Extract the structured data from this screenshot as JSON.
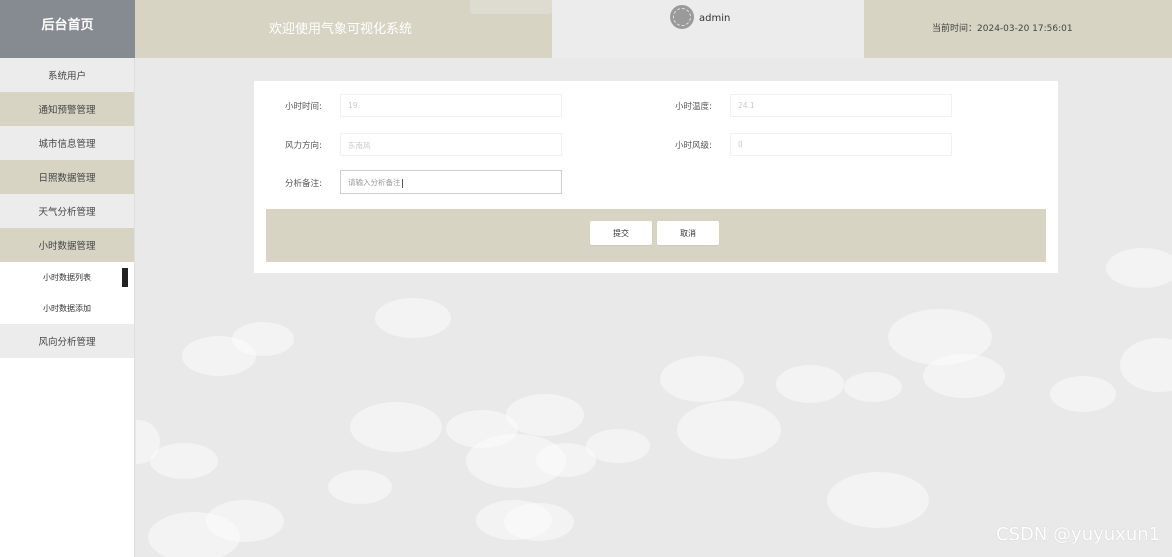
{
  "header": {
    "brand": "后台首页",
    "welcome": "欢迎使用气象可视化系统",
    "username": "admin",
    "time_label": "当前时间：",
    "time_value": "2024-03-20 17:56:01"
  },
  "sidebar": {
    "items": [
      {
        "label": "系统用户"
      },
      {
        "label": "通知预警管理"
      },
      {
        "label": "城市信息管理"
      },
      {
        "label": "日照数据管理"
      },
      {
        "label": "天气分析管理"
      },
      {
        "label": "小时数据管理"
      }
    ],
    "sub_items": [
      {
        "label": "小时数据列表"
      },
      {
        "label": "小时数据添加"
      }
    ],
    "last_item": {
      "label": "风向分析管理"
    }
  },
  "form": {
    "fields": [
      {
        "label": "小时时间:",
        "value": "19"
      },
      {
        "label": "小时温度:",
        "value": "24.1"
      },
      {
        "label": "风力方向:",
        "value": "东南风"
      },
      {
        "label": "小时风级:",
        "value": "0"
      }
    ],
    "remark": {
      "label": "分析备注:",
      "placeholder": "请输入分析备注"
    },
    "submit_label": "提交",
    "cancel_label": "取消"
  },
  "watermark": "CSDN @yuyuxun1",
  "colors": {
    "accent": "#d8d4c4",
    "brand_bg": "#868b92",
    "page_bg": "#e9e9e9"
  }
}
